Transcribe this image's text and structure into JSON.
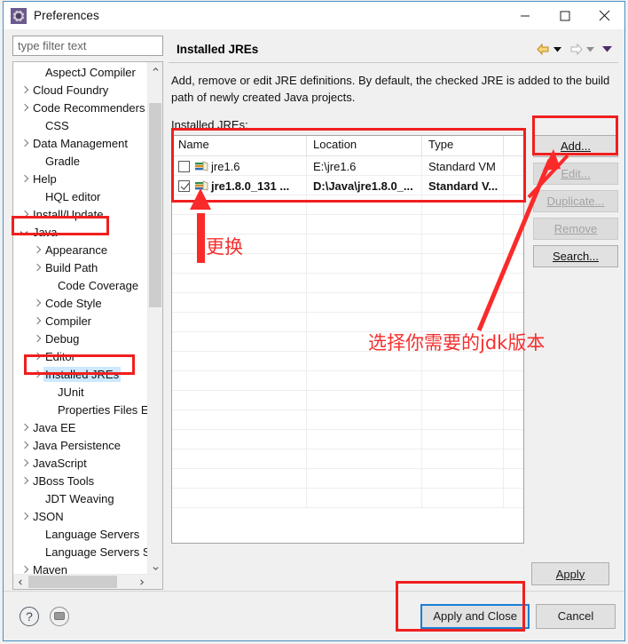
{
  "window": {
    "title": "Preferences",
    "icon": "gear-icon",
    "controls": {
      "minimize": "minimize-icon",
      "maximize": "maximize-icon",
      "close": "close-icon"
    }
  },
  "sidebar": {
    "filter": {
      "placeholder": "type filter text",
      "value": ""
    },
    "items": [
      {
        "label": "AspectJ Compiler",
        "indent": 1,
        "twisty": "none",
        "selected": false
      },
      {
        "label": "Cloud Foundry",
        "indent": 0,
        "twisty": "collapsed",
        "selected": false
      },
      {
        "label": "Code Recommenders",
        "indent": 0,
        "twisty": "collapsed",
        "selected": false
      },
      {
        "label": "CSS",
        "indent": 1,
        "twisty": "none",
        "selected": false
      },
      {
        "label": "Data Management",
        "indent": 0,
        "twisty": "collapsed",
        "selected": false
      },
      {
        "label": "Gradle",
        "indent": 1,
        "twisty": "none",
        "selected": false
      },
      {
        "label": "Help",
        "indent": 0,
        "twisty": "collapsed",
        "selected": false
      },
      {
        "label": "HQL editor",
        "indent": 1,
        "twisty": "none",
        "selected": false
      },
      {
        "label": "Install/Update",
        "indent": 0,
        "twisty": "collapsed",
        "selected": false
      },
      {
        "label": "Java",
        "indent": 0,
        "twisty": "expanded",
        "selected": false
      },
      {
        "label": "Appearance",
        "indent": 1,
        "twisty": "collapsed",
        "selected": false
      },
      {
        "label": "Build Path",
        "indent": 1,
        "twisty": "collapsed",
        "selected": false
      },
      {
        "label": "Code Coverage",
        "indent": 2,
        "twisty": "none",
        "selected": false
      },
      {
        "label": "Code Style",
        "indent": 1,
        "twisty": "collapsed",
        "selected": false
      },
      {
        "label": "Compiler",
        "indent": 1,
        "twisty": "collapsed",
        "selected": false
      },
      {
        "label": "Debug",
        "indent": 1,
        "twisty": "collapsed",
        "selected": false
      },
      {
        "label": "Editor",
        "indent": 1,
        "twisty": "collapsed",
        "selected": false
      },
      {
        "label": "Installed JREs",
        "indent": 1,
        "twisty": "collapsed",
        "selected": true
      },
      {
        "label": "JUnit",
        "indent": 2,
        "twisty": "none",
        "selected": false
      },
      {
        "label": "Properties Files Ed",
        "indent": 2,
        "twisty": "none",
        "selected": false
      },
      {
        "label": "Java EE",
        "indent": 0,
        "twisty": "collapsed",
        "selected": false
      },
      {
        "label": "Java Persistence",
        "indent": 0,
        "twisty": "collapsed",
        "selected": false
      },
      {
        "label": "JavaScript",
        "indent": 0,
        "twisty": "collapsed",
        "selected": false
      },
      {
        "label": "JBoss Tools",
        "indent": 0,
        "twisty": "collapsed",
        "selected": false
      },
      {
        "label": "JDT Weaving",
        "indent": 1,
        "twisty": "none",
        "selected": false
      },
      {
        "label": "JSON",
        "indent": 0,
        "twisty": "collapsed",
        "selected": false
      },
      {
        "label": "Language Servers",
        "indent": 1,
        "twisty": "none",
        "selected": false
      },
      {
        "label": "Language Servers STS",
        "indent": 1,
        "twisty": "none",
        "selected": false
      },
      {
        "label": "Maven",
        "indent": 0,
        "twisty": "collapsed",
        "selected": false
      }
    ]
  },
  "page": {
    "title": "Installed JREs",
    "description": "Add, remove or edit JRE definitions. By default, the checked JRE is added to the build path of newly created Java projects.",
    "table_label": "Installed JREs:",
    "nav": {
      "back": "back-arrow-icon",
      "back_menu": "chevron-down-icon",
      "forward": "forward-arrow-icon",
      "forward_menu": "chevron-down-icon",
      "view_menu": "chevron-down-icon"
    }
  },
  "table": {
    "columns": [
      "Name",
      "Location",
      "Type",
      ""
    ],
    "rows": [
      {
        "checked": false,
        "name": "jre1.6",
        "location": "E:\\jre1.6",
        "type": "Standard VM",
        "bold": false
      },
      {
        "checked": true,
        "name": "jre1.8.0_131 ...",
        "location": "D:\\Java\\jre1.8.0_...",
        "type": "Standard V...",
        "bold": true
      }
    ],
    "empty_rows": 16
  },
  "side_buttons": [
    {
      "label": "Add...",
      "mnemonic": "A",
      "disabled": false
    },
    {
      "label": "Edit...",
      "mnemonic": "E",
      "disabled": true
    },
    {
      "label": "Duplicate...",
      "mnemonic": "i",
      "disabled": true
    },
    {
      "label": "Remove",
      "mnemonic": "R",
      "disabled": true
    },
    {
      "label": "Search...",
      "mnemonic": "S",
      "disabled": false
    }
  ],
  "footer": {
    "apply": "Apply",
    "apply_and_close": "Apply and Close",
    "cancel": "Cancel",
    "help_icon": "question-mark-icon",
    "shell_icon": "shell-toggle-icon"
  },
  "annotations": {
    "replace_text": "更换",
    "choose_jdk_text": "选择你需要的jdk版本",
    "color": "#f42f2f",
    "boxes": [
      {
        "name": "java-node-highlight"
      },
      {
        "name": "installed-jres-node-highlight"
      },
      {
        "name": "jre-table-highlight"
      },
      {
        "name": "add-button-highlight"
      },
      {
        "name": "apply-and-close-highlight"
      }
    ]
  }
}
